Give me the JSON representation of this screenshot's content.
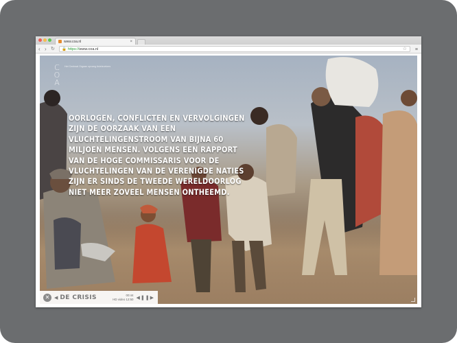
{
  "browser": {
    "tab_title": "www.coa.nl",
    "tab_close": "×",
    "url_scheme": "https://",
    "url_host": "www.coa.nl",
    "controls": {
      "back": "‹",
      "forward": "›",
      "reload": "↻",
      "star": "☆",
      "menu": "≡"
    }
  },
  "site": {
    "logo_lines": [
      "C",
      "O",
      "A"
    ],
    "tagline": "Het Centraal Orgaan opvang Asielzoekers"
  },
  "headline": "OORLOGEN, CONFLICTEN EN VERVOLGINGEN ZIJN DE OORZAAK VAN EEN VLUCHTELINGENSTROOM VAN BIJNA 60 MILJOEN MENSEN. VOLGENS EEN RAPPORT VAN DE HOGE COMMISSARIS VOOR DE VLUCHTELINGEN VAN DE VERENIGDE NATIES ZIJN ER SINDS DE TWEEDE WERELDOORLOG NIET MEER ZOVEEL MENSEN ONTHEEMD.",
  "player": {
    "close_glyph": "✕",
    "prev_glyph": "◀",
    "title": "DE CRISIS",
    "elapsed": "00:44",
    "quality_duration": "HD video 12:50",
    "controls_glyph": "◀❚❚▶"
  },
  "colors": {
    "frame": "#6b6d6f",
    "headline": "#ffffff",
    "secure": "#2a9d3a"
  }
}
